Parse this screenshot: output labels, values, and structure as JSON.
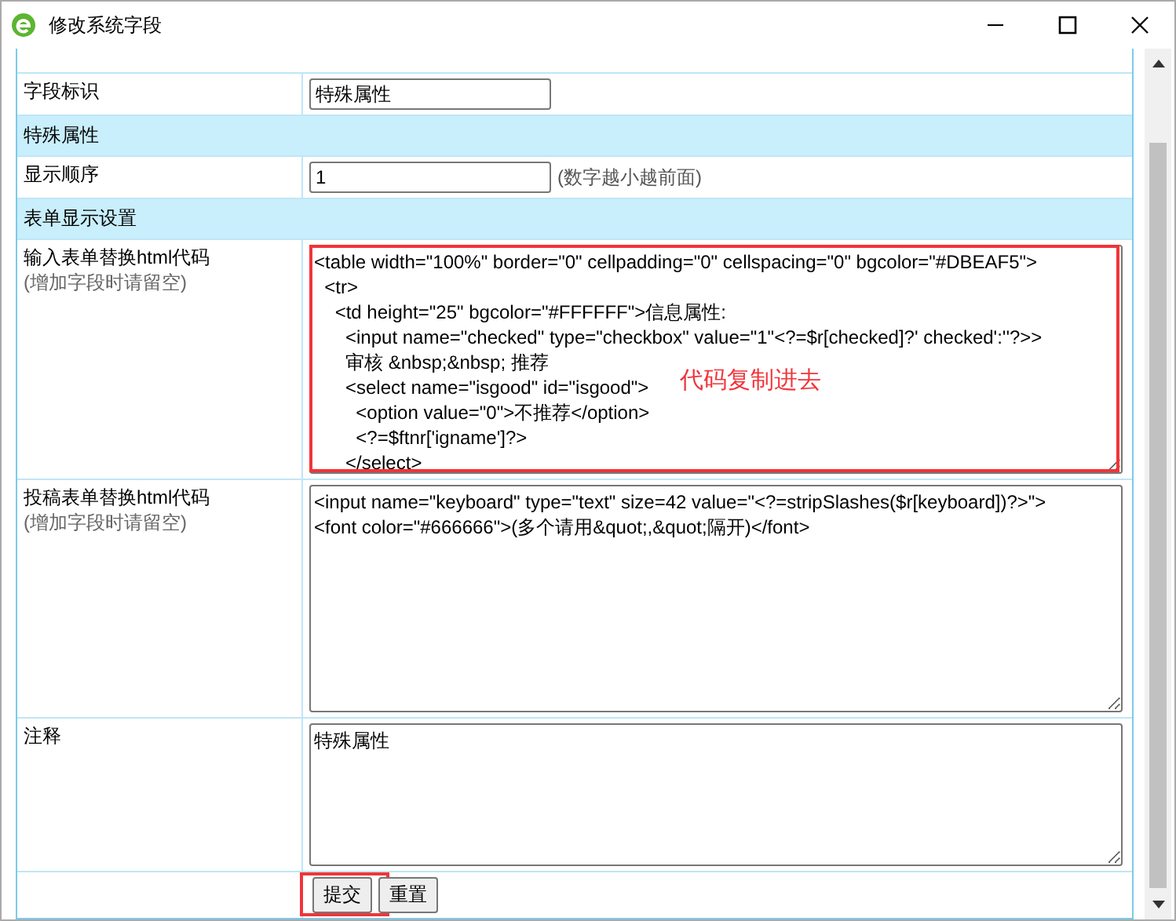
{
  "window": {
    "title": "修改系统字段"
  },
  "rows": [
    {
      "kind": "input",
      "label": "字段标识",
      "value": "特殊属性"
    },
    {
      "kind": "section",
      "label": "特殊属性"
    },
    {
      "kind": "input",
      "label": "显示顺序",
      "value": "1",
      "hint": "(数字越小越前面)"
    },
    {
      "kind": "section",
      "label": "表单显示设置"
    },
    {
      "kind": "code",
      "label": "输入表单替换html代码",
      "note": "(增加字段时请留空)",
      "value": "<table width=\"100%\" border=\"0\" cellpadding=\"0\" cellspacing=\"0\" bgcolor=\"#DBEAF5\">\n  <tr>\n    <td height=\"25\" bgcolor=\"#FFFFFF\">信息属性:\n      <input name=\"checked\" type=\"checkbox\" value=\"1\"<?=$r[checked]?' checked':''?>>\n      审核 &nbsp;&nbsp; 推荐\n      <select name=\"isgood\" id=\"isgood\">\n        <option value=\"0\">不推荐</option>\n        <?=$ftnr['igname']?>\n      </select>",
      "highlighted": true,
      "annotation": "代码复制进去"
    },
    {
      "kind": "code",
      "label": "投稿表单替换html代码",
      "note": "(增加字段时请留空)",
      "value": "<input name=\"keyboard\" type=\"text\" size=42 value=\"<?=stripSlashes($r[keyboard])?>\">\n<font color=\"#666666\">(多个请用&quot;,&quot;隔开)</font>",
      "highlighted": false
    },
    {
      "kind": "note",
      "label": "注释",
      "value": "特殊属性"
    }
  ],
  "buttons": [
    {
      "label": "提交",
      "highlighted": true
    },
    {
      "label": "重置",
      "highlighted": false
    }
  ]
}
